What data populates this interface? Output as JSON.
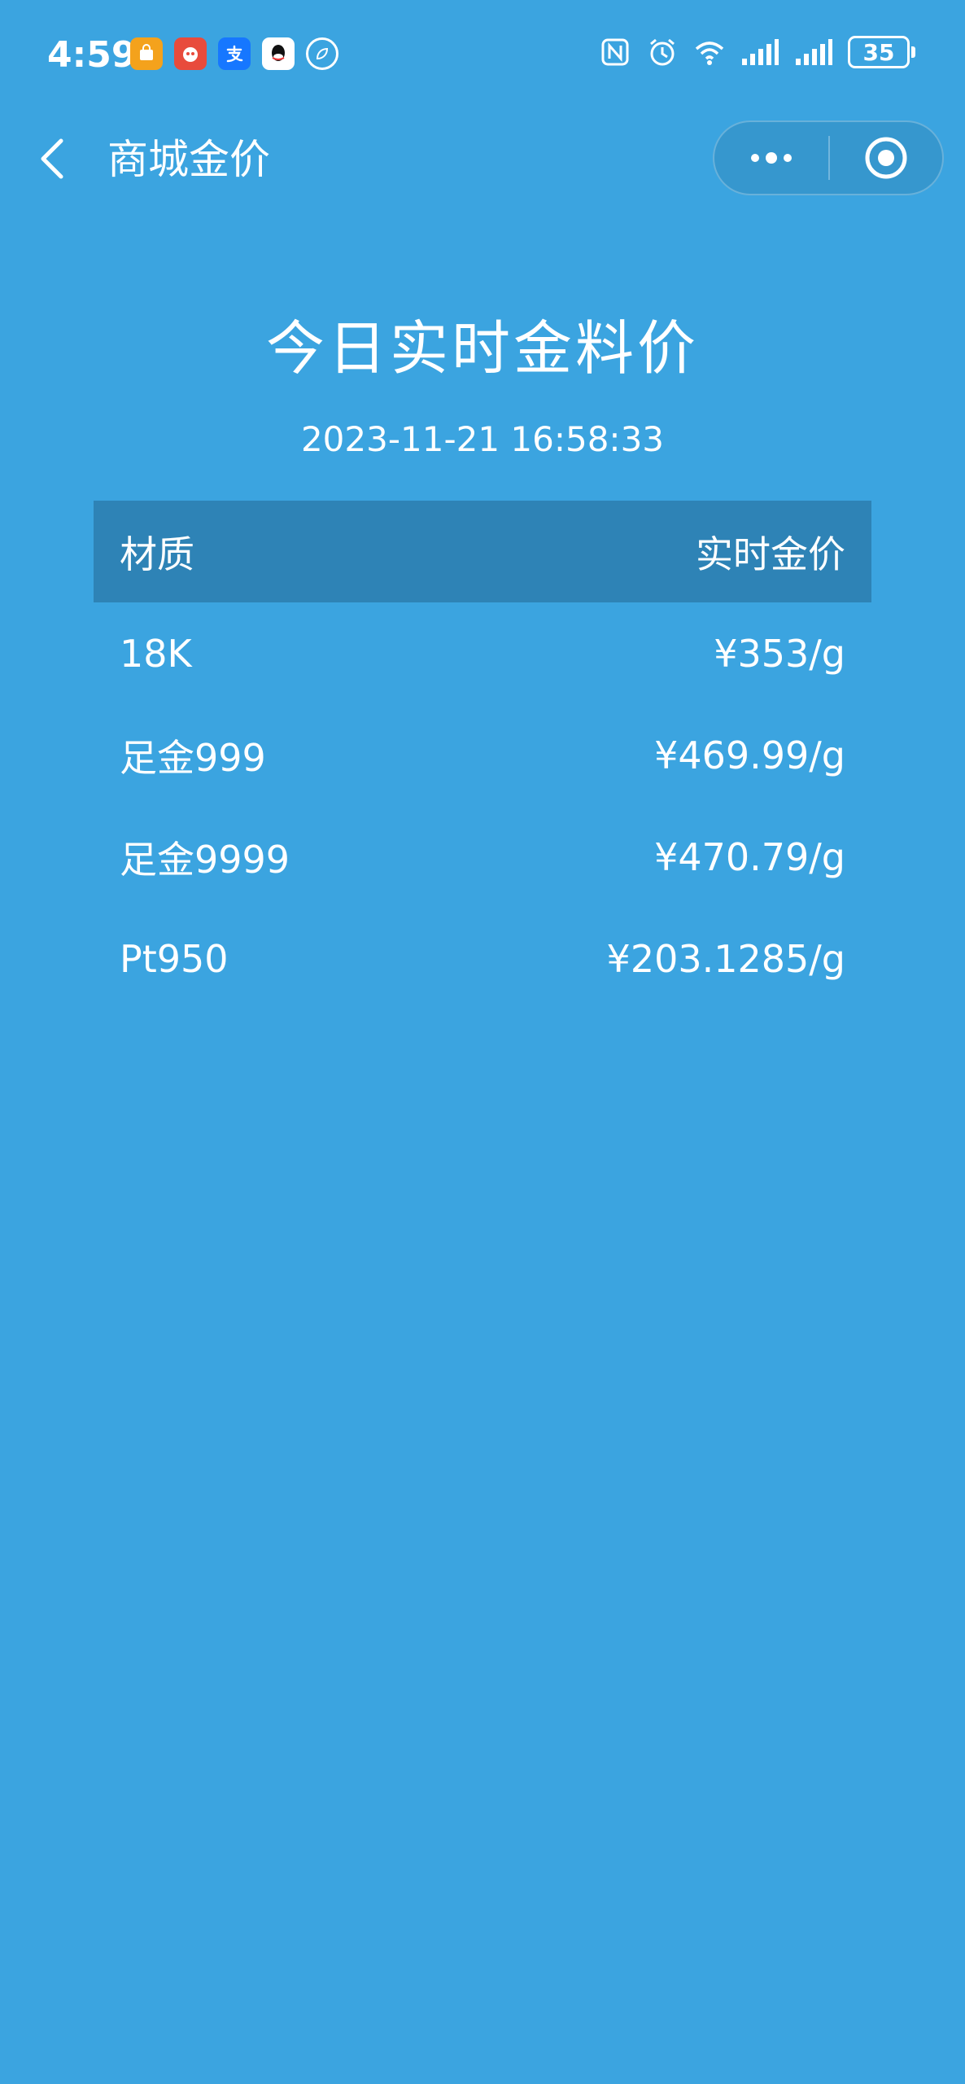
{
  "status_bar": {
    "time": "4:59",
    "battery": "35"
  },
  "nav": {
    "title": "商城金价"
  },
  "main": {
    "title": "今日实时金料价",
    "update_time": "2023-11-21 16:58:33"
  },
  "table": {
    "headers": {
      "material": "材质",
      "price": "实时金价"
    },
    "rows": [
      {
        "material": "18K",
        "price": "¥353/g"
      },
      {
        "material": "足金999",
        "price": "¥469.99/g"
      },
      {
        "material": "足金9999",
        "price": "¥470.79/g"
      },
      {
        "material": "Pt950",
        "price": "¥203.1285/g"
      }
    ]
  },
  "colors": {
    "background": "#3ba4e0",
    "table_header": "#2e83b6",
    "text": "#ffffff"
  }
}
